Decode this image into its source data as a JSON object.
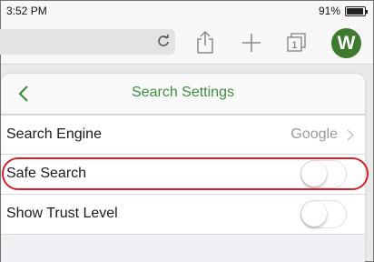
{
  "status_bar": {
    "time": "3:52 PM",
    "battery_percent": "91%"
  },
  "toolbar": {
    "logo_letter": "W",
    "icons": [
      "reload-icon",
      "share-icon",
      "plus-icon",
      "tabs-icon"
    ],
    "tabs_count": "1"
  },
  "popover": {
    "title": "Search Settings",
    "rows": [
      {
        "label": "Search Engine",
        "value": "Google"
      },
      {
        "label": "Safe Search",
        "toggle_on": false
      },
      {
        "label": "Show Trust Level",
        "toggle_on": false
      }
    ]
  },
  "colors": {
    "accent_green": "#3e8e3e",
    "logo_green": "#3d7a2d",
    "highlight_red": "#d6202a"
  }
}
